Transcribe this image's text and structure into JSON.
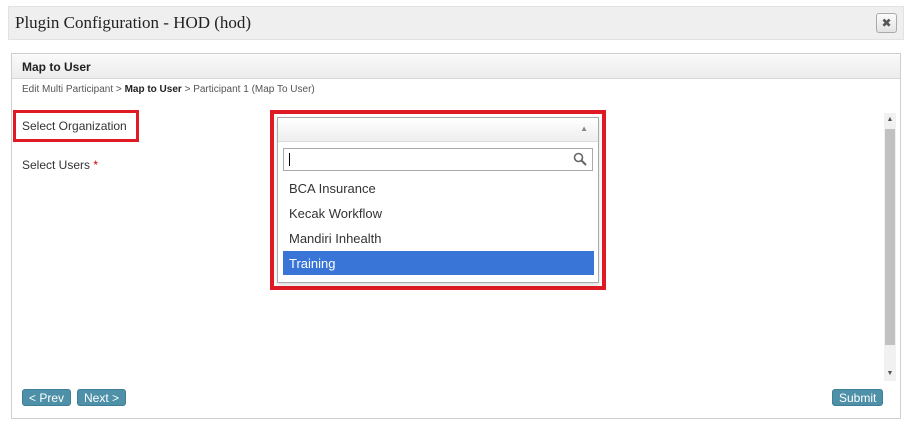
{
  "dialog": {
    "title": "Plugin Configuration - HOD (hod)",
    "close_glyph": "✖"
  },
  "panel": {
    "header": "Map to User"
  },
  "breadcrumb": {
    "step1": "Edit Multi Participant",
    "sep": " > ",
    "current": "Map to User",
    "step3": "Participant 1 (Map To User)"
  },
  "form": {
    "org_label": "Select Organization",
    "users_label": "Select Users",
    "required_mark": "*"
  },
  "dropdown": {
    "search_value": "",
    "options": [
      "BCA Insurance",
      "Kecak Workflow",
      "Mandiri Inhealth",
      "Training"
    ],
    "selected_index": 3
  },
  "buttons": {
    "prev": "< Prev",
    "next": "Next >",
    "submit": "Submit"
  },
  "colors": {
    "accent_highlight": "#e01a22",
    "button": "#4d90a8",
    "selection": "#3875d7"
  }
}
